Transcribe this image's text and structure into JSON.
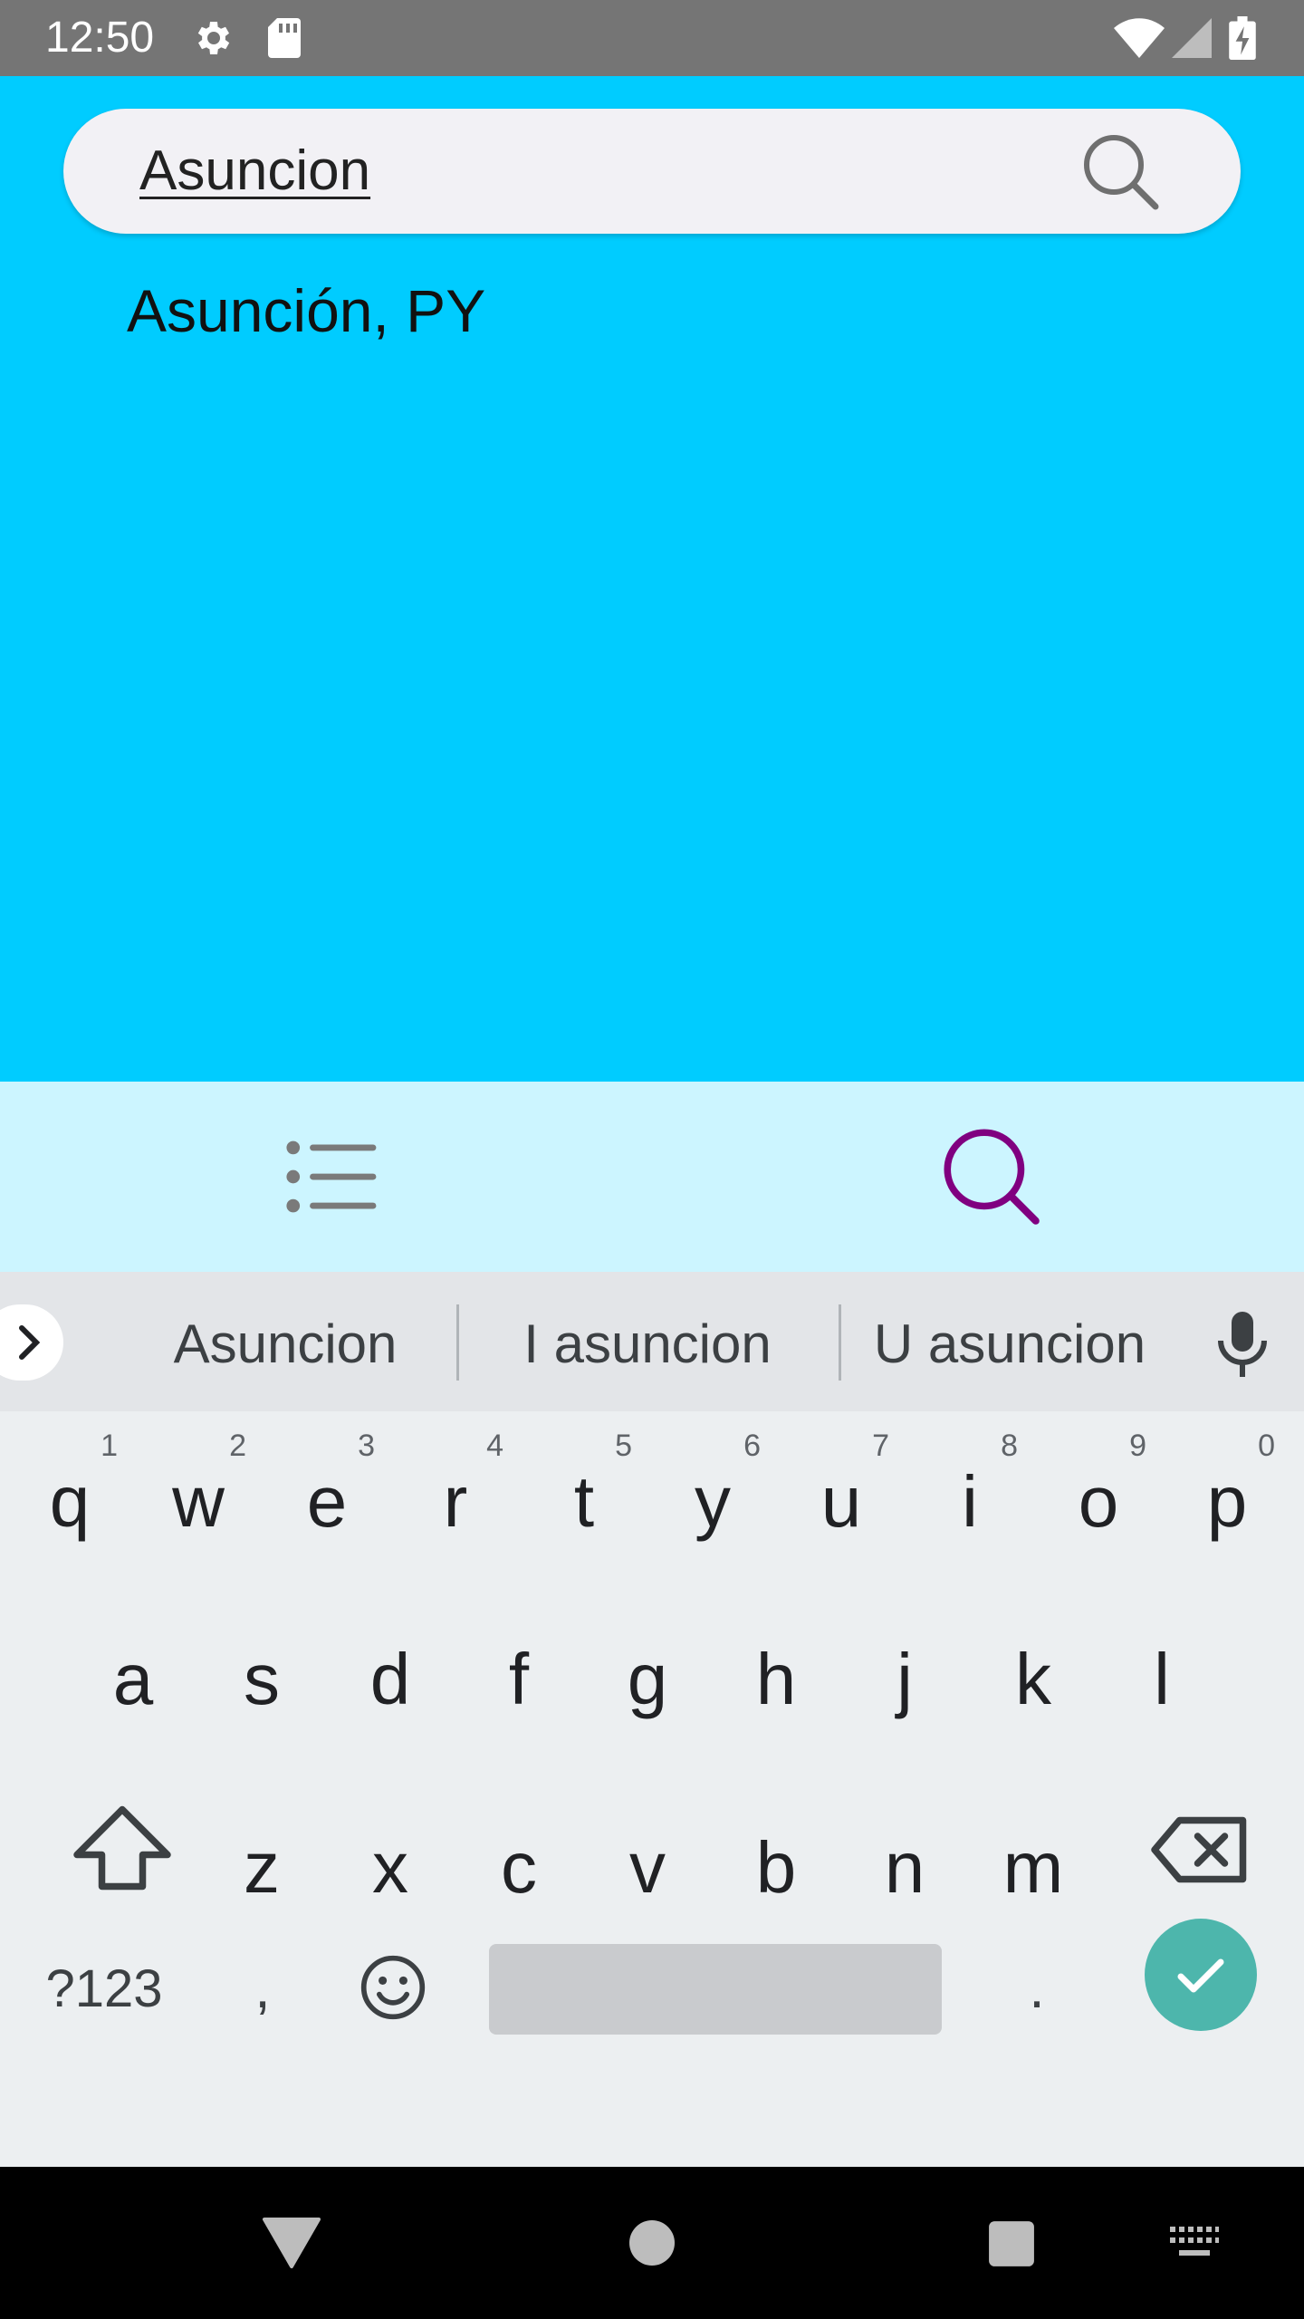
{
  "status_bar": {
    "time": "12:50",
    "icons": [
      "gear-icon",
      "sd-card-icon",
      "wifi-icon",
      "signal-icon",
      "battery-charging-icon"
    ]
  },
  "search": {
    "query": "Asuncion",
    "icon": "search-icon"
  },
  "results": [
    {
      "label": "Asunción, PY"
    }
  ],
  "bottom_nav": {
    "items": [
      {
        "icon": "list-icon",
        "active": false
      },
      {
        "icon": "search-icon",
        "active": true
      }
    ],
    "active_color": "#800080",
    "inactive_color": "#7a7a7a"
  },
  "keyboard": {
    "suggestions": [
      "Asuncion",
      "I asuncion",
      "U asuncion"
    ],
    "row1": [
      {
        "key": "q",
        "hint": "1"
      },
      {
        "key": "w",
        "hint": "2"
      },
      {
        "key": "e",
        "hint": "3"
      },
      {
        "key": "r",
        "hint": "4"
      },
      {
        "key": "t",
        "hint": "5"
      },
      {
        "key": "y",
        "hint": "6"
      },
      {
        "key": "u",
        "hint": "7"
      },
      {
        "key": "i",
        "hint": "8"
      },
      {
        "key": "o",
        "hint": "9"
      },
      {
        "key": "p",
        "hint": "0"
      }
    ],
    "row2": [
      "a",
      "s",
      "d",
      "f",
      "g",
      "h",
      "j",
      "k",
      "l"
    ],
    "row3": [
      "z",
      "x",
      "c",
      "v",
      "b",
      "n",
      "m"
    ],
    "symbols_label": "?123",
    "comma_label": ",",
    "period_label": ".",
    "enter_color": "#4db6ac"
  },
  "colors": {
    "app_background": "#00ccff",
    "bottom_nav_background": "#ccf5ff",
    "status_bar": "#757575"
  }
}
